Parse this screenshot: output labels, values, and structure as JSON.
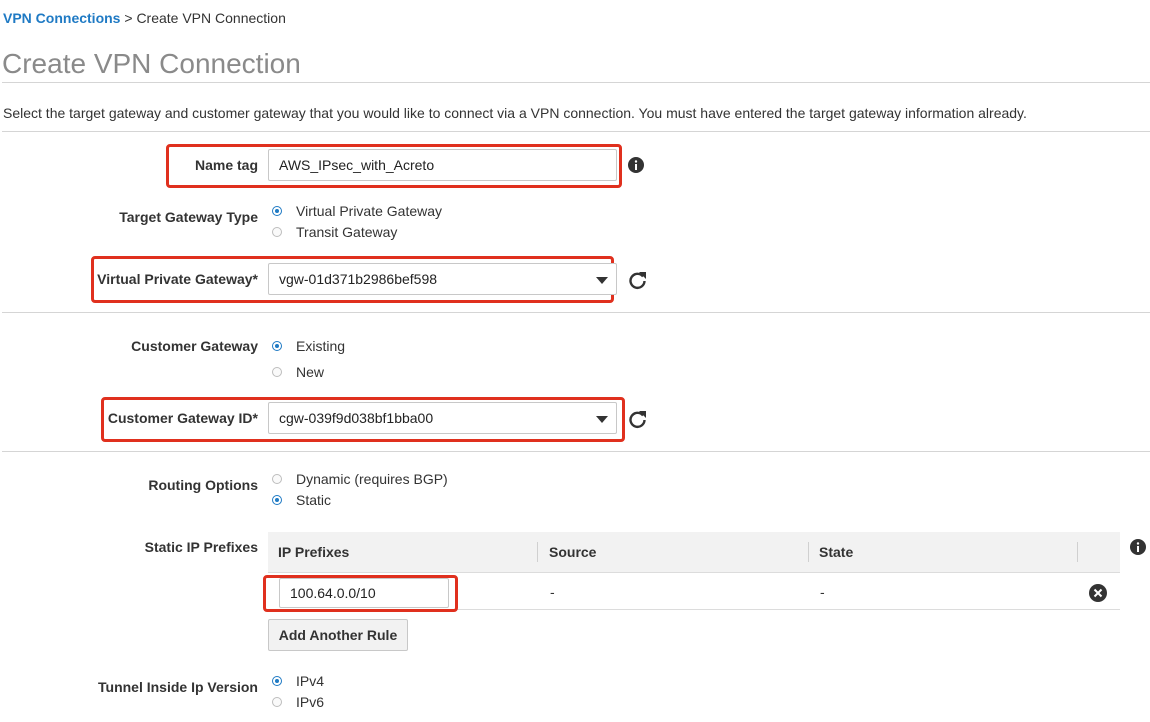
{
  "breadcrumb": {
    "parent": "VPN Connections",
    "separator": ">",
    "current": "Create VPN Connection"
  },
  "page": {
    "title": "Create VPN Connection",
    "description": "Select the target gateway and customer gateway that you would like to connect via a VPN connection. You must have entered the target gateway information already."
  },
  "name_tag": {
    "label": "Name tag",
    "value": "AWS_IPsec_with_Acreto"
  },
  "target_gateway_type": {
    "label": "Target Gateway Type",
    "options": [
      "Virtual Private Gateway",
      "Transit Gateway"
    ],
    "selected": "Virtual Private Gateway"
  },
  "virtual_private_gateway": {
    "label": "Virtual Private Gateway*",
    "value": "vgw-01d371b2986bef598"
  },
  "customer_gateway": {
    "label": "Customer Gateway",
    "options": [
      "Existing",
      "New"
    ],
    "selected": "Existing"
  },
  "customer_gateway_id": {
    "label": "Customer Gateway ID*",
    "value": "cgw-039f9d038bf1bba00"
  },
  "routing_options": {
    "label": "Routing Options",
    "options": [
      "Dynamic (requires BGP)",
      "Static"
    ],
    "selected": "Static"
  },
  "static_ip_prefixes": {
    "label": "Static IP Prefixes",
    "columns": [
      "IP Prefixes",
      "Source",
      "State"
    ],
    "rows": [
      {
        "prefix": "100.64.0.0/10",
        "source": "-",
        "state": "-"
      }
    ],
    "add_button": "Add Another Rule"
  },
  "tunnel_inside_ip_version": {
    "label": "Tunnel Inside Ip Version",
    "options": [
      "IPv4",
      "IPv6"
    ],
    "selected": "IPv4"
  },
  "colors": {
    "link": "#1f7ac4",
    "highlight": "#e0301e",
    "radio_selected": "#1f7ac4"
  },
  "icons": {
    "info": "info-icon",
    "refresh": "refresh-icon",
    "remove": "remove-circle-icon",
    "dropdown": "caret-down-icon"
  }
}
